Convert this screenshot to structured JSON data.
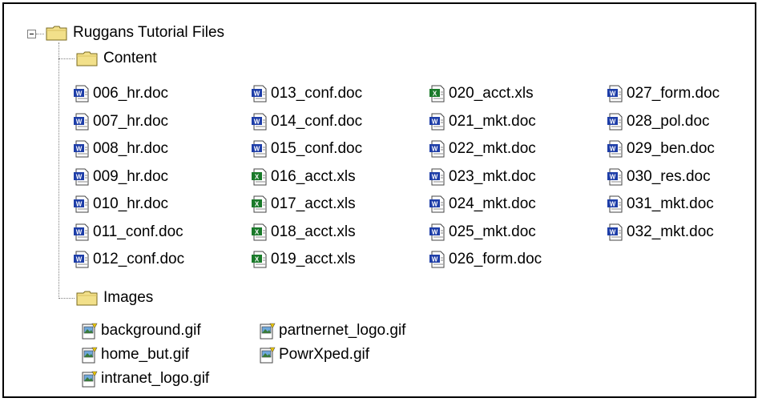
{
  "tree": {
    "root": {
      "label": "Ruggans Tutorial Files",
      "expanded": true,
      "icon": "folder-icon"
    },
    "content_folder": {
      "label": "Content",
      "icon": "folder-icon"
    },
    "content_files": [
      [
        "006_hr.doc",
        "007_hr.doc",
        "008_hr.doc",
        "009_hr.doc",
        "010_hr.doc",
        "011_conf.doc",
        "012_conf.doc"
      ],
      [
        "013_conf.doc",
        "014_conf.doc",
        "015_conf.doc",
        "016_acct.xls",
        "017_acct.xls",
        "018_acct.xls",
        "019_acct.xls"
      ],
      [
        "020_acct.xls",
        "021_mkt.doc",
        "022_mkt.doc",
        "023_mkt.doc",
        "024_mkt.doc",
        "025_mkt.doc",
        "026_form.doc"
      ],
      [
        "027_form.doc",
        "028_pol.doc",
        "029_ben.doc",
        "030_res.doc",
        "031_mkt.doc",
        "032_mkt.doc"
      ]
    ],
    "images_folder": {
      "label": "Images",
      "icon": "folder-icon"
    },
    "image_files": [
      [
        "background.gif",
        "home_but.gif",
        "intranet_logo.gif"
      ],
      [
        "partnernet_logo.gif",
        "PowrXped.gif"
      ]
    ]
  },
  "colors": {
    "folder": "#f2e08a",
    "folder_edge": "#7a6a1e",
    "doc_blue": "#1e3ea8",
    "xls_green": "#1a7a2a",
    "gif_yellow": "#e6c200"
  }
}
